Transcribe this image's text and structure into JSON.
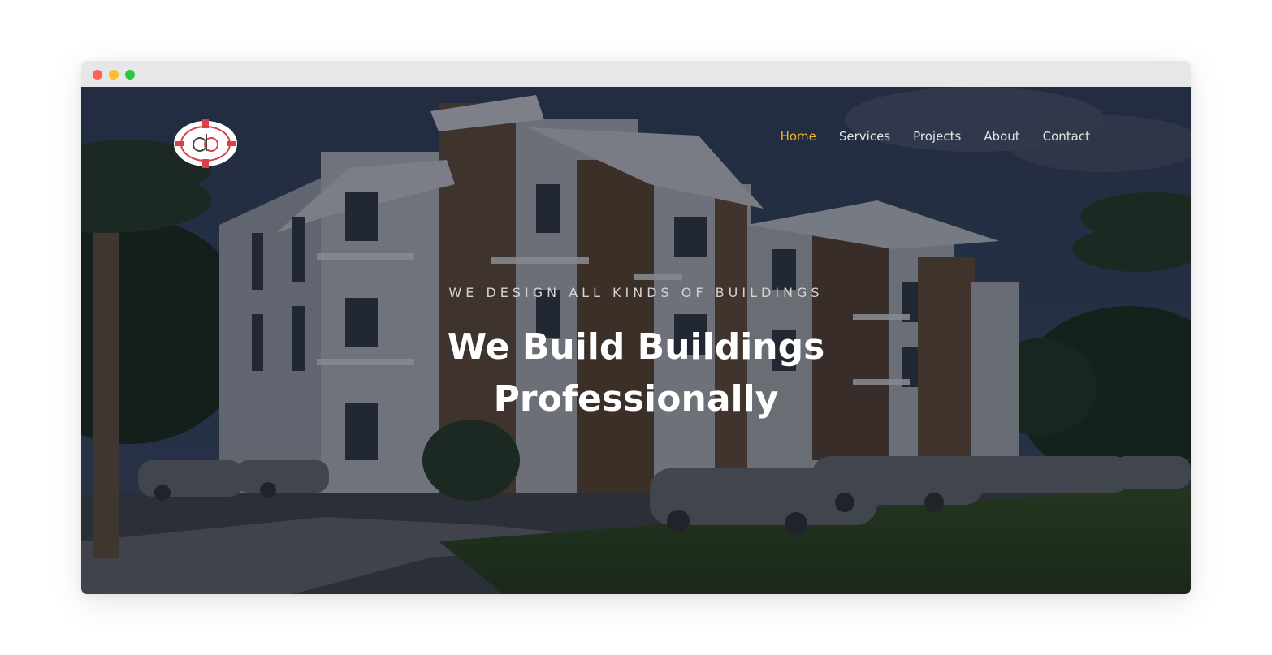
{
  "window": {
    "controls": [
      "close",
      "minimize",
      "maximize"
    ]
  },
  "header": {
    "logo_icon": "cb-logo-icon",
    "nav": [
      {
        "label": "Home",
        "active": true
      },
      {
        "label": "Services",
        "active": false
      },
      {
        "label": "Projects",
        "active": false
      },
      {
        "label": "About",
        "active": false
      },
      {
        "label": "Contact",
        "active": false
      }
    ]
  },
  "hero": {
    "eyebrow": "WE DESIGN ALL KINDS OF BUILDINGS",
    "headline_line1": "We Build Buildings",
    "headline_line2": "Professionally"
  },
  "colors": {
    "accent": "#f2b21b",
    "nav_text": "#e4e4e4",
    "headline": "#ffffff"
  }
}
